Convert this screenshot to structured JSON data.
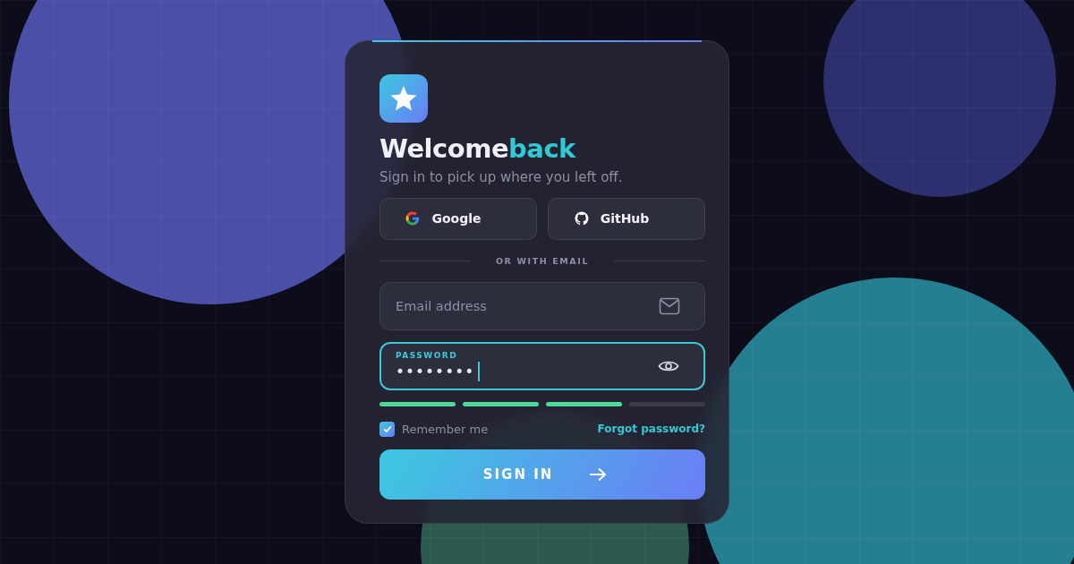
{
  "title": {
    "text": "Welcome",
    "accent": "back"
  },
  "subtitle": "Sign in to pick up where you left off.",
  "social_buttons": [
    {
      "kind": "google",
      "label": "Google"
    },
    {
      "kind": "github",
      "label": "GitHub"
    }
  ],
  "divider": "OR WITH EMAIL",
  "email_field": {
    "placeholder": "Email address",
    "focused": false
  },
  "password_field": {
    "label": "PASSWORD",
    "value": "••••••••",
    "focused": true
  },
  "strength_segments": [
    {
      "filled": true
    },
    {
      "filled": true
    },
    {
      "filled": true
    },
    {
      "filled": false
    }
  ],
  "remember": {
    "label": "Remember me",
    "checked": true
  },
  "forgot_link": "Forgot password?",
  "submit": {
    "label": "SIGN IN"
  }
}
